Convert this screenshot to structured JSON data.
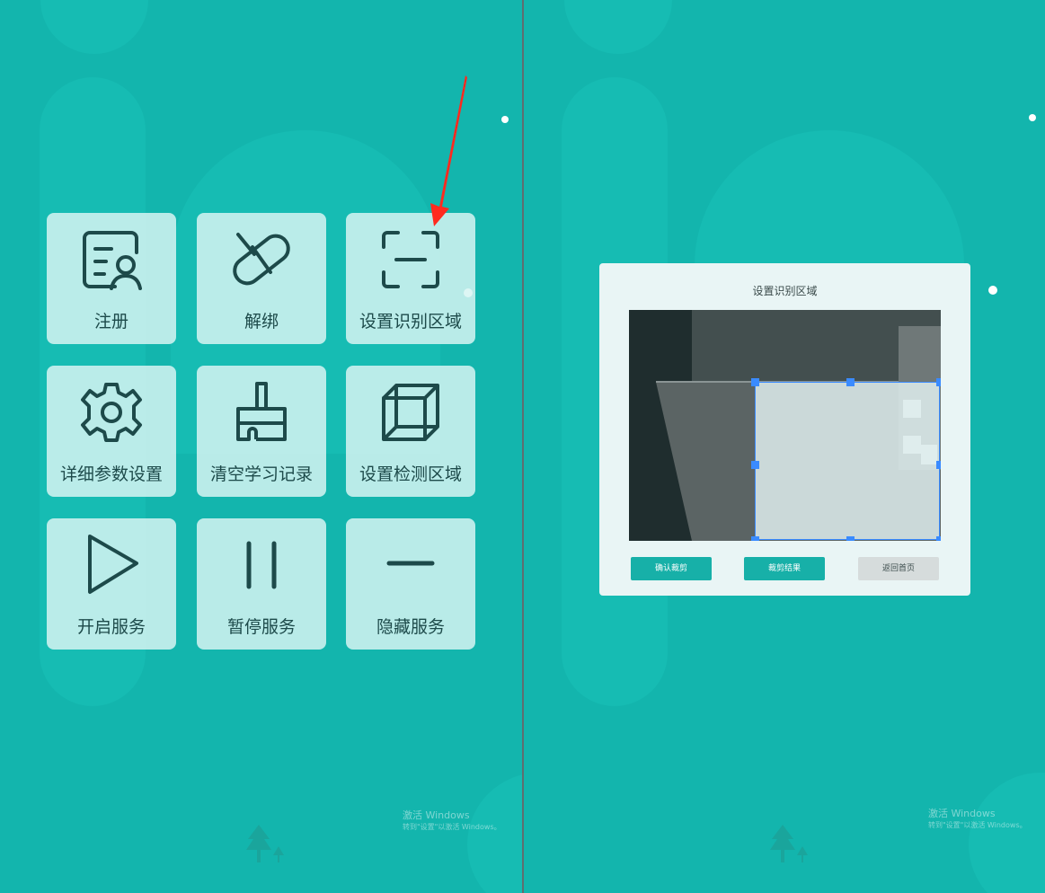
{
  "menu": {
    "tiles": [
      {
        "label": "注册",
        "icon": "register-user-icon"
      },
      {
        "label": "解绑",
        "icon": "unbind-pill-icon"
      },
      {
        "label": "设置识别区域",
        "icon": "scan-frame-icon"
      },
      {
        "label": "详细参数设置",
        "icon": "gear-icon"
      },
      {
        "label": "清空学习记录",
        "icon": "broom-icon"
      },
      {
        "label": "设置检测区域",
        "icon": "cube-icon"
      },
      {
        "label": "开启服务",
        "icon": "play-icon"
      },
      {
        "label": "暂停服务",
        "icon": "pause-icon"
      },
      {
        "label": "隐藏服务",
        "icon": "minus-icon"
      }
    ]
  },
  "annotation": {
    "icon": "red-arrow-icon",
    "color": "#ff2a1f"
  },
  "watermark": {
    "line1": "激活 Windows",
    "line2": "转到\"设置\"以激活 Windows。"
  },
  "dialog": {
    "title": "设置识别区域",
    "buttons": {
      "confirm_crop": "确认裁剪",
      "crop_result": "裁剪结果",
      "back_home": "返回首页"
    }
  },
  "colors": {
    "background": "#13b5ad",
    "tile": "#d7f5f2",
    "icon_stroke": "#1d4a4a",
    "accent": "#17b0a8",
    "crop_handle": "#3a8bff"
  }
}
